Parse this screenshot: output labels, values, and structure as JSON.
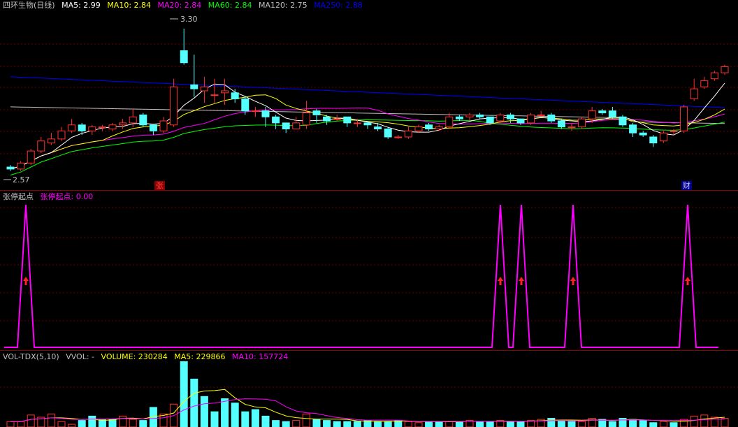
{
  "main": {
    "stock_name": "四环生物(日线)",
    "ma": [
      {
        "label": "MA5: 2.99",
        "color": "#ffffff"
      },
      {
        "label": "MA10: 2.84",
        "color": "#ffff00"
      },
      {
        "label": "MA20: 2.84",
        "color": "#ff00ff"
      },
      {
        "label": "MA60: 2.84",
        "color": "#00ff00"
      },
      {
        "label": "MA120: 2.75",
        "color": "#c0c0c0"
      },
      {
        "label": "MA250: 2.88",
        "color": "#0000ff"
      }
    ],
    "high_label": "3.30",
    "low_label": "2.57",
    "tag_zhang": "张",
    "tag_cai": "财"
  },
  "ind": {
    "title": "张停起点",
    "value_label": "张停起点: 0.00"
  },
  "vol": {
    "title": "VOL-TDX(5,10)",
    "vvol": "VVOL: -",
    "volume": "VOLUME: 230284",
    "ma5": "MA5: 229866",
    "ma10": "MA10: 157724"
  },
  "chart_data": {
    "type": "candlestick",
    "price_range": [
      2.57,
      3.3
    ],
    "candles": [
      [
        2.58,
        2.57,
        2.59,
        2.56
      ],
      [
        2.57,
        2.6,
        2.61,
        2.56
      ],
      [
        2.6,
        2.66,
        2.67,
        2.59
      ],
      [
        2.66,
        2.71,
        2.73,
        2.65
      ],
      [
        2.7,
        2.72,
        2.75,
        2.69
      ],
      [
        2.72,
        2.76,
        2.78,
        2.71
      ],
      [
        2.76,
        2.79,
        2.82,
        2.75
      ],
      [
        2.79,
        2.76,
        2.8,
        2.74
      ],
      [
        2.76,
        2.78,
        2.79,
        2.74
      ],
      [
        2.78,
        2.78,
        2.79,
        2.76
      ],
      [
        2.77,
        2.79,
        2.8,
        2.76
      ],
      [
        2.79,
        2.8,
        2.82,
        2.77
      ],
      [
        2.8,
        2.83,
        2.87,
        2.78
      ],
      [
        2.84,
        2.79,
        2.85,
        2.78
      ],
      [
        2.79,
        2.76,
        2.79,
        2.74
      ],
      [
        2.76,
        2.81,
        2.83,
        2.75
      ],
      [
        2.79,
        2.98,
        3.02,
        2.78
      ],
      [
        3.16,
        3.1,
        3.27,
        3.09
      ],
      [
        2.99,
        2.97,
        3.14,
        2.93
      ],
      [
        2.96,
        2.98,
        3.03,
        2.9
      ],
      [
        2.94,
        2.94,
        3.02,
        2.9
      ],
      [
        2.95,
        2.96,
        3.02,
        2.89
      ],
      [
        2.95,
        2.92,
        2.97,
        2.9
      ],
      [
        2.92,
        2.86,
        2.93,
        2.84
      ],
      [
        2.86,
        2.86,
        2.88,
        2.83
      ],
      [
        2.86,
        2.83,
        2.88,
        2.78
      ],
      [
        2.83,
        2.8,
        2.84,
        2.77
      ],
      [
        2.8,
        2.77,
        2.8,
        2.75
      ],
      [
        2.77,
        2.8,
        2.83,
        2.77
      ],
      [
        2.79,
        2.85,
        2.91,
        2.77
      ],
      [
        2.86,
        2.84,
        2.87,
        2.8
      ],
      [
        2.83,
        2.81,
        2.84,
        2.79
      ],
      [
        2.82,
        2.82,
        2.84,
        2.81
      ],
      [
        2.83,
        2.8,
        2.83,
        2.78
      ],
      [
        2.8,
        2.8,
        2.82,
        2.78
      ],
      [
        2.8,
        2.79,
        2.81,
        2.77
      ],
      [
        2.78,
        2.77,
        2.8,
        2.76
      ],
      [
        2.77,
        2.73,
        2.78,
        2.72
      ],
      [
        2.73,
        2.73,
        2.74,
        2.72
      ],
      [
        2.73,
        2.76,
        2.78,
        2.72
      ],
      [
        2.76,
        2.78,
        2.79,
        2.75
      ],
      [
        2.79,
        2.77,
        2.8,
        2.76
      ],
      [
        2.77,
        2.78,
        2.79,
        2.76
      ],
      [
        2.78,
        2.83,
        2.85,
        2.77
      ],
      [
        2.83,
        2.82,
        2.84,
        2.81
      ],
      [
        2.83,
        2.84,
        2.85,
        2.81
      ],
      [
        2.84,
        2.83,
        2.85,
        2.82
      ],
      [
        2.83,
        2.8,
        2.83,
        2.79
      ],
      [
        2.81,
        2.84,
        2.85,
        2.8
      ],
      [
        2.84,
        2.82,
        2.85,
        2.8
      ],
      [
        2.82,
        2.8,
        2.82,
        2.79
      ],
      [
        2.8,
        2.84,
        2.85,
        2.79
      ],
      [
        2.84,
        2.84,
        2.86,
        2.83
      ],
      [
        2.84,
        2.81,
        2.85,
        2.8
      ],
      [
        2.81,
        2.78,
        2.82,
        2.77
      ],
      [
        2.78,
        2.78,
        2.8,
        2.76
      ],
      [
        2.78,
        2.82,
        2.83,
        2.77
      ],
      [
        2.82,
        2.86,
        2.88,
        2.8
      ],
      [
        2.86,
        2.85,
        2.87,
        2.84
      ],
      [
        2.86,
        2.83,
        2.88,
        2.82
      ],
      [
        2.83,
        2.79,
        2.84,
        2.78
      ],
      [
        2.79,
        2.75,
        2.8,
        2.73
      ],
      [
        2.75,
        2.74,
        2.76,
        2.73
      ],
      [
        2.73,
        2.7,
        2.74,
        2.68
      ],
      [
        2.71,
        2.75,
        2.76,
        2.7
      ],
      [
        2.76,
        2.76,
        2.77,
        2.74
      ],
      [
        2.76,
        2.88,
        2.89,
        2.75
      ],
      [
        2.92,
        2.97,
        3.02,
        2.91
      ],
      [
        2.98,
        3.01,
        3.03,
        2.97
      ],
      [
        3.02,
        3.05,
        3.06,
        3.01
      ],
      [
        3.05,
        3.08,
        3.09,
        3.04
      ]
    ],
    "volumes": [
      [
        1.0,
        1
      ],
      [
        1.0,
        1
      ],
      [
        2.2,
        1
      ],
      [
        1.8,
        1
      ],
      [
        2.4,
        1
      ],
      [
        1.0,
        1
      ],
      [
        0.5,
        1
      ],
      [
        1.2,
        0
      ],
      [
        2.0,
        0
      ],
      [
        1.4,
        0
      ],
      [
        1.4,
        0
      ],
      [
        2.0,
        1
      ],
      [
        1.4,
        1
      ],
      [
        1.2,
        0
      ],
      [
        3.6,
        0
      ],
      [
        2.4,
        1
      ],
      [
        4.2,
        1
      ],
      [
        12.0,
        0
      ],
      [
        8.8,
        0
      ],
      [
        5.6,
        0
      ],
      [
        2.8,
        0
      ],
      [
        5.2,
        0
      ],
      [
        4.4,
        0
      ],
      [
        2.8,
        0
      ],
      [
        3.2,
        0
      ],
      [
        2.0,
        0
      ],
      [
        1.2,
        0
      ],
      [
        1.0,
        0
      ],
      [
        1.2,
        1
      ],
      [
        2.4,
        1
      ],
      [
        1.4,
        0
      ],
      [
        1.2,
        0
      ],
      [
        1.0,
        0
      ],
      [
        1.0,
        0
      ],
      [
        1.0,
        0
      ],
      [
        1.2,
        0
      ],
      [
        1.0,
        0
      ],
      [
        1.0,
        0
      ],
      [
        1.2,
        0
      ],
      [
        1.0,
        1
      ],
      [
        0.8,
        1
      ],
      [
        1.0,
        0
      ],
      [
        1.0,
        0
      ],
      [
        1.0,
        1
      ],
      [
        1.0,
        0
      ],
      [
        1.2,
        1
      ],
      [
        1.0,
        0
      ],
      [
        1.0,
        0
      ],
      [
        1.2,
        1
      ],
      [
        1.0,
        0
      ],
      [
        1.0,
        0
      ],
      [
        1.2,
        1
      ],
      [
        1.4,
        1
      ],
      [
        1.6,
        0
      ],
      [
        1.2,
        0
      ],
      [
        1.0,
        0
      ],
      [
        1.0,
        1
      ],
      [
        1.6,
        1
      ],
      [
        1.4,
        0
      ],
      [
        1.0,
        0
      ],
      [
        1.6,
        0
      ],
      [
        1.4,
        0
      ],
      [
        1.2,
        0
      ],
      [
        0.8,
        0
      ],
      [
        1.0,
        1
      ],
      [
        0.8,
        0
      ],
      [
        1.4,
        1
      ],
      [
        2.0,
        1
      ],
      [
        2.2,
        1
      ],
      [
        1.8,
        1
      ],
      [
        1.6,
        1
      ]
    ]
  }
}
